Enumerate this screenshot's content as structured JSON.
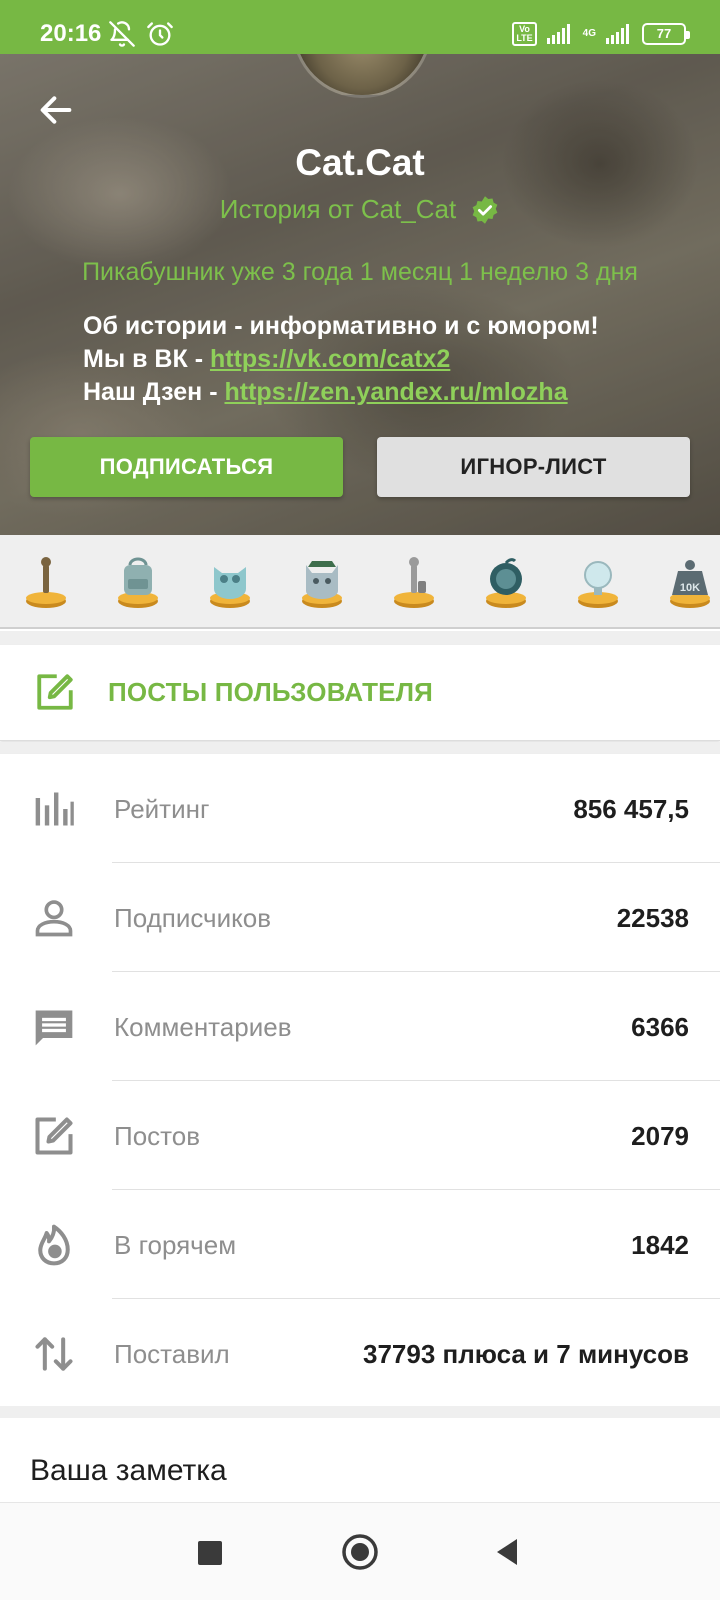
{
  "status_bar": {
    "time": "20:16",
    "battery": "77",
    "network": "4G",
    "volte": "Vo LTE"
  },
  "profile": {
    "name": "Cat.Cat",
    "subtitle": "История от Cat_Cat",
    "member_since": "Пикабушник уже 3 года 1 месяц 1 неделю 3 дня",
    "about_line1": "Об истории - информативно и с юмором!",
    "about_line2_prefix": "Мы в ВК - ",
    "about_line2_link": "https://vk.com/catx2",
    "about_line3_prefix": "Наш Дзен - ",
    "about_line3_link": "https://zen.yandex.ru/mlozha"
  },
  "buttons": {
    "subscribe": "ПОДПИСАТЬСЯ",
    "ignore": "ИГНОР-ЛИСТ"
  },
  "awards": {
    "last_badge_text": "10K"
  },
  "posts_link": {
    "label": "ПОСТЫ ПОЛЬЗОВАТЕЛЯ"
  },
  "stats": [
    {
      "label": "Рейтинг",
      "value": "856 457,5",
      "icon": "bar-chart-icon"
    },
    {
      "label": "Подписчиков",
      "value": "22538",
      "icon": "person-icon"
    },
    {
      "label": "Комментариев",
      "value": "6366",
      "icon": "comment-icon"
    },
    {
      "label": "Постов",
      "value": "2079",
      "icon": "edit-icon"
    },
    {
      "label": "В горячем",
      "value": "1842",
      "icon": "flame-icon"
    },
    {
      "label": "Поставил",
      "value": "37793 плюса и 7 минусов",
      "icon": "swap-vertical-icon"
    }
  ],
  "note": {
    "label": "Ваша заметка"
  },
  "colors": {
    "accent": "#77b844",
    "header_text_green": "#7dc04b",
    "stat_label": "#8e8e8e"
  }
}
